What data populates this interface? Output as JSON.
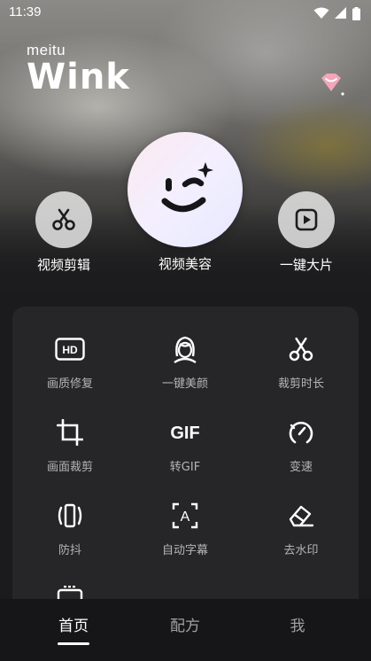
{
  "status_bar": {
    "time": "11:39"
  },
  "brand": {
    "meitu": "meitu",
    "wink": "Wink"
  },
  "features": [
    {
      "label": "视频剪辑",
      "icon": "scissors-icon"
    },
    {
      "label": "视频美容",
      "icon": "wink-face-icon"
    },
    {
      "label": "一键大片",
      "icon": "play-icon"
    }
  ],
  "tools": [
    {
      "label": "画质修复",
      "icon": "hd-icon",
      "icon_text": "HD"
    },
    {
      "label": "一键美颜",
      "icon": "face-beauty-icon"
    },
    {
      "label": "裁剪时长",
      "icon": "scissors-icon"
    },
    {
      "label": "画面裁剪",
      "icon": "crop-icon"
    },
    {
      "label": "转GIF",
      "icon": "gif-icon",
      "icon_text": "GIF"
    },
    {
      "label": "变速",
      "icon": "speed-gauge-icon"
    },
    {
      "label": "防抖",
      "icon": "stabilize-icon"
    },
    {
      "label": "自动字幕",
      "icon": "auto-subtitle-icon",
      "icon_text": "A"
    },
    {
      "label": "去水印",
      "icon": "eraser-icon"
    }
  ],
  "bottom_nav": [
    {
      "label": "首页",
      "active": true
    },
    {
      "label": "配方",
      "active": false
    },
    {
      "label": "我",
      "active": false
    }
  ],
  "colors": {
    "accent": "#ffffff",
    "panel": "#262628",
    "diamond": "#f2a6b8"
  }
}
